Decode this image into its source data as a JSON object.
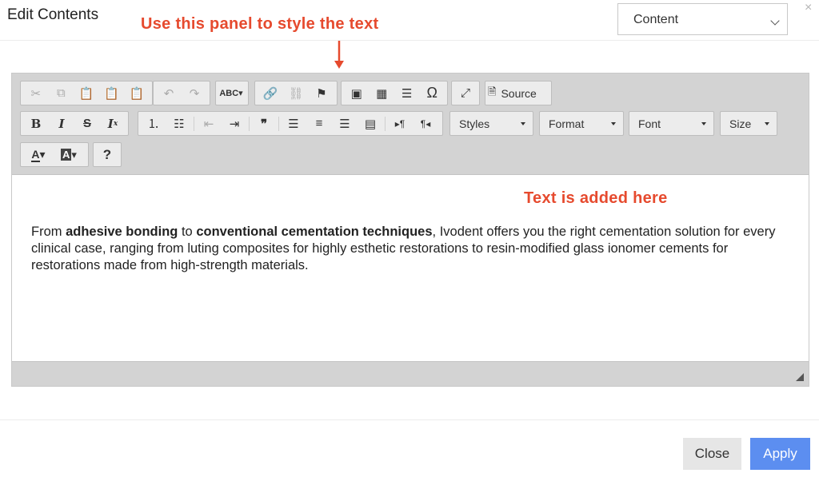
{
  "dialog": {
    "title": "Edit Contents",
    "close_glyph": "×"
  },
  "select": {
    "value": "Content"
  },
  "annotations": {
    "top": "Use this panel to style the text",
    "content": "Text is added here"
  },
  "toolbar": {
    "source_label": "Source",
    "styles_label": "Styles",
    "format_label": "Format",
    "font_label": "Font",
    "size_label": "Size",
    "help_label": "?"
  },
  "content": {
    "p1_a": "From ",
    "p1_b": "adhesive bonding",
    "p1_c": " to ",
    "p1_d": "conventional cementation techniques",
    "p1_e": ", Ivodent offers you the right cementation solution for every clinical case, ranging from luting composites for highly esthetic restorations to resin-modified glass ionomer cements for restorations made from high-strength materials."
  },
  "footer": {
    "close_label": "Close",
    "apply_label": "Apply"
  },
  "colors": {
    "annotation": "#e64a2e",
    "apply_bg": "#5c8ef0",
    "toolbar_bg": "#d3d3d3"
  }
}
